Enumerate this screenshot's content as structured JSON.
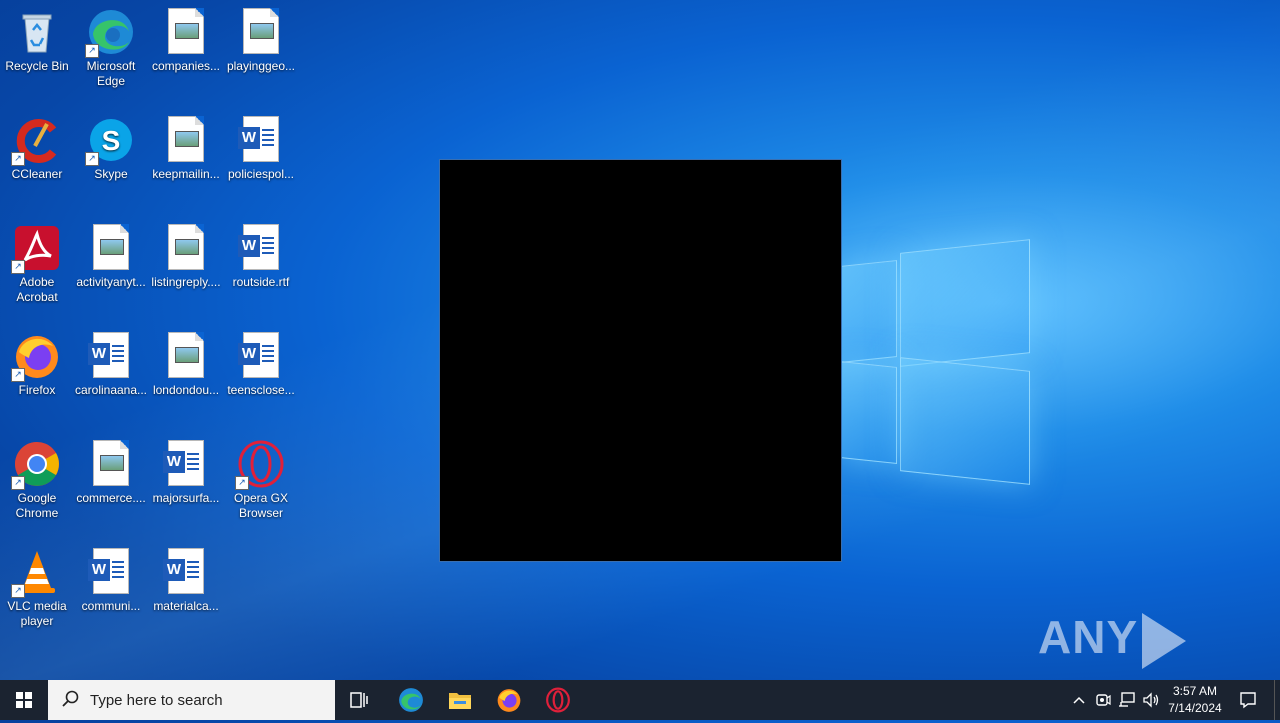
{
  "desktop": {
    "icons": [
      {
        "label": "Recycle Bin",
        "icon": "recycle-bin-icon"
      },
      {
        "label": "Microsoft Edge",
        "icon": "edge-icon"
      },
      {
        "label": "companies...",
        "icon": "image-file-icon"
      },
      {
        "label": "playinggeo...",
        "icon": "image-file-icon"
      },
      {
        "label": "CCleaner",
        "icon": "ccleaner-icon"
      },
      {
        "label": "Skype",
        "icon": "skype-icon"
      },
      {
        "label": "keepmailin...",
        "icon": "image-file-icon"
      },
      {
        "label": "policiespol...",
        "icon": "word-doc-icon"
      },
      {
        "label": "Adobe Acrobat",
        "icon": "acrobat-icon"
      },
      {
        "label": "activityanyt...",
        "icon": "image-file-icon"
      },
      {
        "label": "listingreply....",
        "icon": "image-file-icon"
      },
      {
        "label": "routside.rtf",
        "icon": "word-doc-icon"
      },
      {
        "label": "Firefox",
        "icon": "firefox-icon"
      },
      {
        "label": "carolinaana...",
        "icon": "word-doc-icon"
      },
      {
        "label": "londondou...",
        "icon": "image-file-icon"
      },
      {
        "label": "teensclose...",
        "icon": "word-doc-icon"
      },
      {
        "label": "Google Chrome",
        "icon": "chrome-icon"
      },
      {
        "label": "commerce....",
        "icon": "image-file-icon"
      },
      {
        "label": "majorsurfa...",
        "icon": "word-doc-icon"
      },
      {
        "label": "Opera GX Browser",
        "icon": "opera-gx-icon"
      },
      {
        "label": "VLC media player",
        "icon": "vlc-icon"
      },
      {
        "label": "communi...",
        "icon": "word-doc-icon"
      },
      {
        "label": "materialca...",
        "icon": "word-doc-icon"
      }
    ]
  },
  "watermark": {
    "left": "ANY",
    "right": "RUN"
  },
  "taskbar": {
    "search_placeholder": "Type here to search",
    "pinned": [
      "task-view-icon",
      "edge-icon",
      "file-explorer-icon",
      "firefox-icon",
      "opera-icon"
    ],
    "clock_time": "3:57 AM",
    "clock_date": "7/14/2024"
  },
  "colors": {
    "taskbar": "#1b2330",
    "desktop_accent": "#0a63d2"
  }
}
